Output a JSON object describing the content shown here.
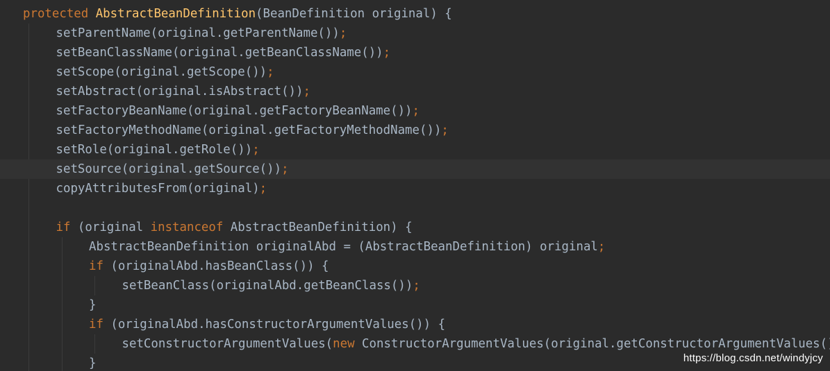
{
  "editor": {
    "theme": "darcula",
    "colors": {
      "background": "#2b2b2b",
      "current_line": "#323232",
      "keyword": "#cc7832",
      "text": "#a9b7c6",
      "watermark": "#ffffff"
    },
    "highlighted_line": 8,
    "lines": [
      {
        "indent": 0,
        "tokens": [
          {
            "t": "protected",
            "k": "kw"
          },
          {
            "t": " AbstractBeanDefinition",
            "k": "method"
          },
          {
            "t": "(BeanDefinition original) {",
            "k": "plain"
          }
        ]
      },
      {
        "indent": 1,
        "tokens": [
          {
            "t": "setParentName(original.getParentName())",
            "k": "plain"
          },
          {
            "t": ";",
            "k": "semi"
          }
        ]
      },
      {
        "indent": 1,
        "tokens": [
          {
            "t": "setBeanClassName(original.getBeanClassName())",
            "k": "plain"
          },
          {
            "t": ";",
            "k": "semi"
          }
        ]
      },
      {
        "indent": 1,
        "tokens": [
          {
            "t": "setScope(original.getScope())",
            "k": "plain"
          },
          {
            "t": ";",
            "k": "semi"
          }
        ]
      },
      {
        "indent": 1,
        "tokens": [
          {
            "t": "setAbstract(original.isAbstract())",
            "k": "plain"
          },
          {
            "t": ";",
            "k": "semi"
          }
        ]
      },
      {
        "indent": 1,
        "tokens": [
          {
            "t": "setFactoryBeanName(original.getFactoryBeanName())",
            "k": "plain"
          },
          {
            "t": ";",
            "k": "semi"
          }
        ]
      },
      {
        "indent": 1,
        "tokens": [
          {
            "t": "setFactoryMethodName(original.getFactoryMethodName())",
            "k": "plain"
          },
          {
            "t": ";",
            "k": "semi"
          }
        ]
      },
      {
        "indent": 1,
        "tokens": [
          {
            "t": "setRole(original.getRole())",
            "k": "plain"
          },
          {
            "t": ";",
            "k": "semi"
          }
        ]
      },
      {
        "indent": 1,
        "tokens": [
          {
            "t": "setSource(original.getSource())",
            "k": "plain"
          },
          {
            "t": ";",
            "k": "semi"
          }
        ]
      },
      {
        "indent": 1,
        "tokens": [
          {
            "t": "copyAttributesFrom(original)",
            "k": "plain"
          },
          {
            "t": ";",
            "k": "semi"
          }
        ]
      },
      {
        "indent": 0,
        "tokens": []
      },
      {
        "indent": 1,
        "tokens": [
          {
            "t": "if",
            "k": "kw"
          },
          {
            "t": " (original ",
            "k": "plain"
          },
          {
            "t": "instanceof",
            "k": "kw"
          },
          {
            "t": " AbstractBeanDefinition) {",
            "k": "plain"
          }
        ]
      },
      {
        "indent": 2,
        "tokens": [
          {
            "t": "AbstractBeanDefinition originalAbd = (AbstractBeanDefinition) original",
            "k": "plain"
          },
          {
            "t": ";",
            "k": "semi"
          }
        ]
      },
      {
        "indent": 2,
        "tokens": [
          {
            "t": "if",
            "k": "kw"
          },
          {
            "t": " (originalAbd.hasBeanClass()) {",
            "k": "plain"
          }
        ]
      },
      {
        "indent": 3,
        "tokens": [
          {
            "t": "setBeanClass(originalAbd.getBeanClass())",
            "k": "plain"
          },
          {
            "t": ";",
            "k": "semi"
          }
        ]
      },
      {
        "indent": 2,
        "tokens": [
          {
            "t": "}",
            "k": "plain"
          }
        ]
      },
      {
        "indent": 2,
        "tokens": [
          {
            "t": "if",
            "k": "kw"
          },
          {
            "t": " (originalAbd.hasConstructorArgumentValues()) {",
            "k": "plain"
          }
        ]
      },
      {
        "indent": 3,
        "tokens": [
          {
            "t": "setConstructorArgumentValues(",
            "k": "plain"
          },
          {
            "t": "new",
            "k": "kw"
          },
          {
            "t": " ConstructorArgumentValues(original.getConstructorArgumentValues()))",
            "k": "plain"
          },
          {
            "t": ";",
            "k": "semi"
          }
        ]
      },
      {
        "indent": 2,
        "tokens": [
          {
            "t": "}",
            "k": "plain"
          }
        ]
      }
    ]
  },
  "watermark": {
    "text": "https://blog.csdn.net/windyjcy"
  }
}
